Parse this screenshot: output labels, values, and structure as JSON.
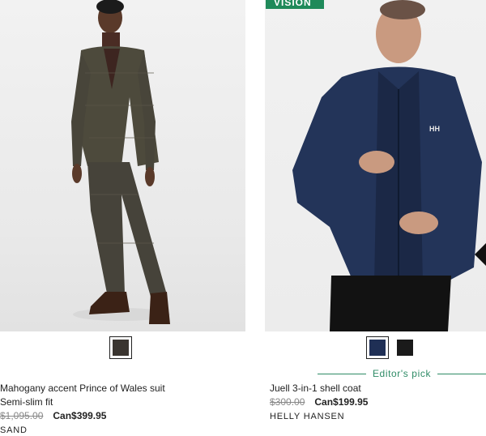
{
  "products": [
    {
      "name": "Mahogany accent Prince of Wales suit",
      "subtitle": "Semi-slim fit",
      "old_price": "$1,095.00",
      "new_price": "Can$399.95",
      "brand": "SAND",
      "swatches": [
        {
          "color": "#3a3530",
          "selected": true
        }
      ]
    },
    {
      "badge": "VISION",
      "editors_pick": "Editor's pick",
      "name": "Juell 3-in-1 shell coat",
      "old_price": "$300.00",
      "new_price": "Can$199.95",
      "brand": "HELLY HANSEN",
      "swatches": [
        {
          "color": "#1f2f55",
          "selected": true
        },
        {
          "color": "#1a1a1a",
          "selected": false
        }
      ]
    }
  ]
}
